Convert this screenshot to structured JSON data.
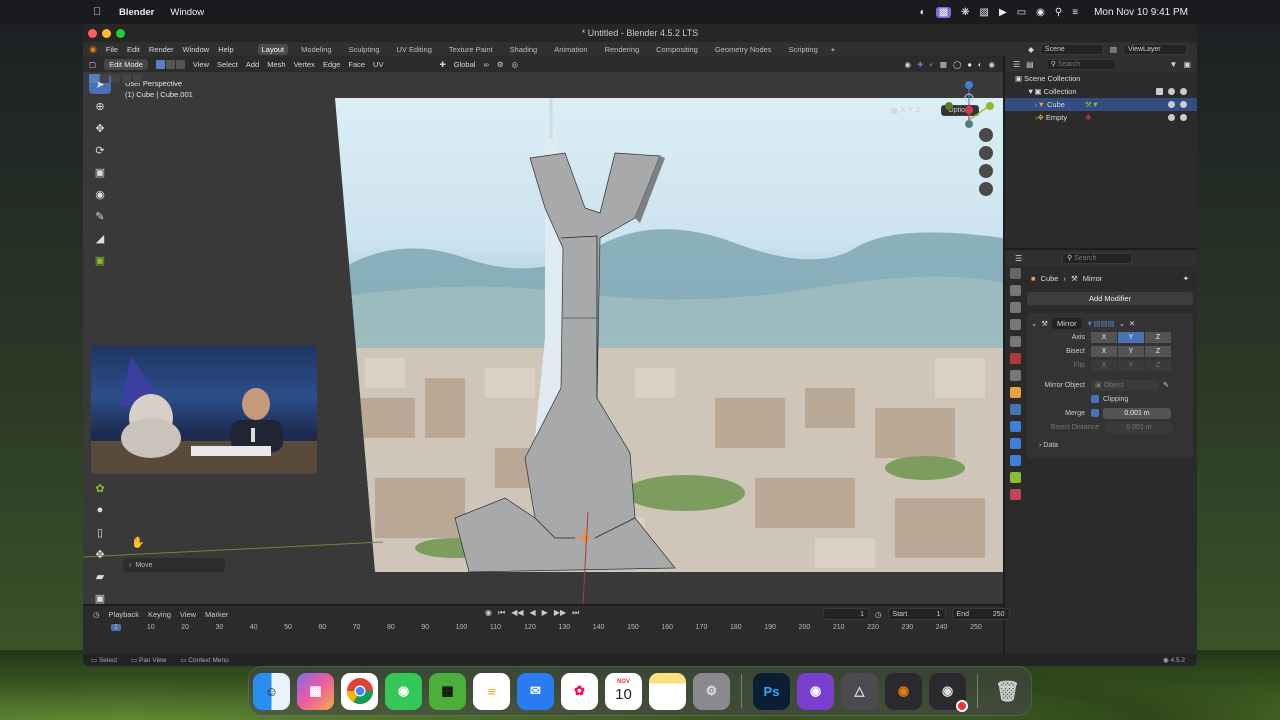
{
  "menubar": {
    "app": "Blender",
    "window": "Window",
    "clock": "Mon Nov 10  9:41 PM"
  },
  "blender": {
    "title": "* Untitled - Blender 4.5.2 LTS",
    "top_menus": [
      "File",
      "Edit",
      "Render",
      "Window",
      "Help"
    ],
    "workspaces": [
      "Layout",
      "Modeling",
      "Sculpting",
      "UV Editing",
      "Texture Paint",
      "Shading",
      "Animation",
      "Rendering",
      "Compositing",
      "Geometry Nodes",
      "Scripting"
    ],
    "active_workspace": "Layout",
    "scene": "Scene",
    "view_layer": "ViewLayer"
  },
  "viewport": {
    "mode": "Edit Mode",
    "menus": [
      "View",
      "Select",
      "Add",
      "Mesh",
      "Vertex",
      "Edge",
      "Face",
      "UV"
    ],
    "orientation": "Global",
    "xyz": [
      "X",
      "Y",
      "Z"
    ],
    "options": "Options",
    "perspective": "User Perspective",
    "object_info": "(1) Cube | Cube.001",
    "last_op": "Move"
  },
  "outliner": {
    "search_placeholder": "Search",
    "root": "Scene Collection",
    "collection": "Collection",
    "items": [
      "Cube",
      "Empty"
    ]
  },
  "properties": {
    "search_placeholder": "Search",
    "object": "Cube",
    "modifier_crumb": "Mirror",
    "add_modifier": "Add Modifier",
    "modifier_name": "Mirror",
    "axis_label": "Axis",
    "bisect_label": "Bisect",
    "flip_label": "Flip",
    "axis_letters": [
      "X",
      "Y",
      "Z"
    ],
    "mirror_object_label": "Mirror Object",
    "mirror_object_placeholder": "Object",
    "clipping_label": "Clipping",
    "merge_label": "Merge",
    "merge_value": "0.001 m",
    "bisect_distance_label": "Bisect Distance",
    "bisect_distance_value": "0.001 m",
    "data_label": "Data"
  },
  "timeline": {
    "menus": [
      "Playback",
      "Keying",
      "View",
      "Marker"
    ],
    "current_frame": "1",
    "start_label": "Start",
    "start": "1",
    "end_label": "End",
    "end": "250",
    "ruler": [
      "1",
      "10",
      "20",
      "30",
      "40",
      "50",
      "60",
      "70",
      "80",
      "90",
      "100",
      "110",
      "120",
      "130",
      "140",
      "150",
      "160",
      "170",
      "180",
      "190",
      "200",
      "210",
      "220",
      "230",
      "240",
      "250"
    ]
  },
  "statusbar": {
    "select": "Select",
    "pan": "Pan View",
    "context": "Context Menu",
    "version": "4.5.2"
  },
  "dock": {
    "calendar_month": "NOV",
    "calendar_day": "10",
    "photoshop": "Ps"
  },
  "colors": {
    "accent": "#4772b3",
    "selection": "#334d80",
    "x_axis": "#e0334f",
    "y_axis": "#8cbc2e",
    "z_axis": "#3d7fd9"
  }
}
